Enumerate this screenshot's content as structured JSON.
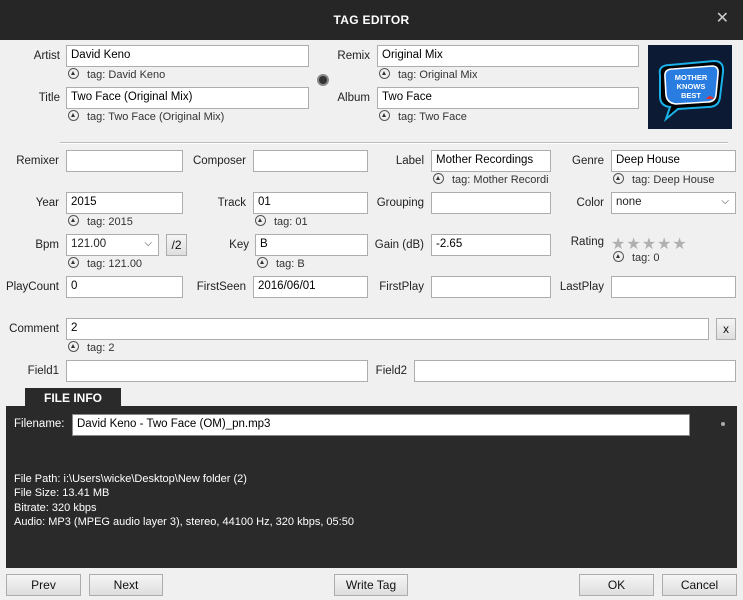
{
  "window": {
    "title": "TAG EDITOR",
    "close_glyph": "✕"
  },
  "top": {
    "artist": {
      "label": "Artist",
      "value": "David Keno",
      "tag": "tag: David Keno"
    },
    "title": {
      "label": "Title",
      "value": "Two Face (Original Mix)",
      "tag": "tag: Two Face (Original Mix)"
    },
    "remix": {
      "label": "Remix",
      "value": "Original Mix",
      "tag": "tag: Original Mix"
    },
    "album": {
      "label": "Album",
      "value": "Two Face",
      "tag": "tag: Two Face"
    }
  },
  "cover": {
    "line1": "MOTHER",
    "line2": "KNOWS",
    "line3": "BEST"
  },
  "fields": {
    "remixer": {
      "label": "Remixer",
      "value": ""
    },
    "composer": {
      "label": "Composer",
      "value": ""
    },
    "label": {
      "label": "Label",
      "value": "Mother Recordings",
      "tag": "tag: Mother Recordi"
    },
    "genre": {
      "label": "Genre",
      "value": "Deep House",
      "tag": "tag: Deep House"
    },
    "year": {
      "label": "Year",
      "value": "2015",
      "tag": "tag: 2015"
    },
    "track": {
      "label": "Track",
      "value": "01",
      "tag": "tag: 01"
    },
    "grouping": {
      "label": "Grouping",
      "value": ""
    },
    "color": {
      "label": "Color",
      "value": "none"
    },
    "bpm": {
      "label": "Bpm",
      "value": "121.00",
      "tag": "tag: 121.00",
      "half_label": "/2"
    },
    "key": {
      "label": "Key",
      "value": "B",
      "tag": "tag: B"
    },
    "gain": {
      "label": "Gain (dB)",
      "value": "-2.65"
    },
    "rating": {
      "label": "Rating",
      "value": 0,
      "max": 5,
      "tag": "tag: 0"
    },
    "playcount": {
      "label": "PlayCount",
      "value": "0"
    },
    "firstseen": {
      "label": "FirstSeen",
      "value": "2016/06/01"
    },
    "firstplay": {
      "label": "FirstPlay",
      "value": ""
    },
    "lastplay": {
      "label": "LastPlay",
      "value": ""
    },
    "comment": {
      "label": "Comment",
      "value": "2",
      "tag": "tag: 2",
      "clear_label": "x"
    },
    "field1": {
      "label": "Field1",
      "value": ""
    },
    "field2": {
      "label": "Field2",
      "value": ""
    }
  },
  "file_info": {
    "tab_label": "FILE INFO",
    "filename_label": "Filename:",
    "filename": "David Keno - Two Face (OM)_pn.mp3",
    "path": "File Path: i:\\Users\\wicke\\Desktop\\New folder (2)",
    "size": "File Size: 13.41 MB",
    "bitrate": "Bitrate: 320 kbps",
    "audio": "Audio: MP3 (MPEG audio layer 3), stereo, 44100 Hz, 320 kbps, 05:50"
  },
  "buttons": {
    "prev": "Prev",
    "next": "Next",
    "write_tag": "Write Tag",
    "ok": "OK",
    "cancel": "Cancel"
  },
  "colors": {
    "titlebar": "#262626",
    "panel": "#2a2a2a",
    "background": "#f0f0f0"
  }
}
